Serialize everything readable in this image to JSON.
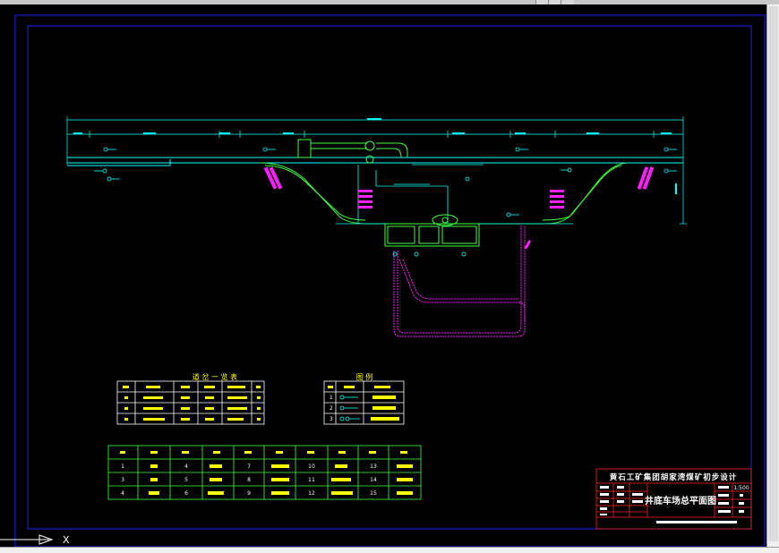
{
  "colors": {
    "background": "#000000",
    "frame": "#2020ff",
    "track": "#00ffff",
    "green": "#40ff40",
    "magenta": "#ff20ff",
    "yellow": "#ffff00",
    "red": "#ff2020",
    "white": "#ffffff"
  },
  "title_block": {
    "company": "黄石工矿集团胡家湾煤矿初步设计",
    "drawing_title": "井底车场总平面图",
    "scale": "1:500"
  },
  "table_left": {
    "title": "道 岔 一 览 表"
  },
  "table_mid": {
    "title": "图 例",
    "row_numbers": [
      "1",
      "2",
      "3"
    ]
  },
  "table_bottom": {
    "numbers": [
      "1",
      "3",
      "2",
      "4",
      "5",
      "6",
      "7",
      "8",
      "9",
      "10",
      "11",
      "12",
      "13",
      "14",
      "15"
    ]
  },
  "ucs": {
    "x_label": "X"
  }
}
